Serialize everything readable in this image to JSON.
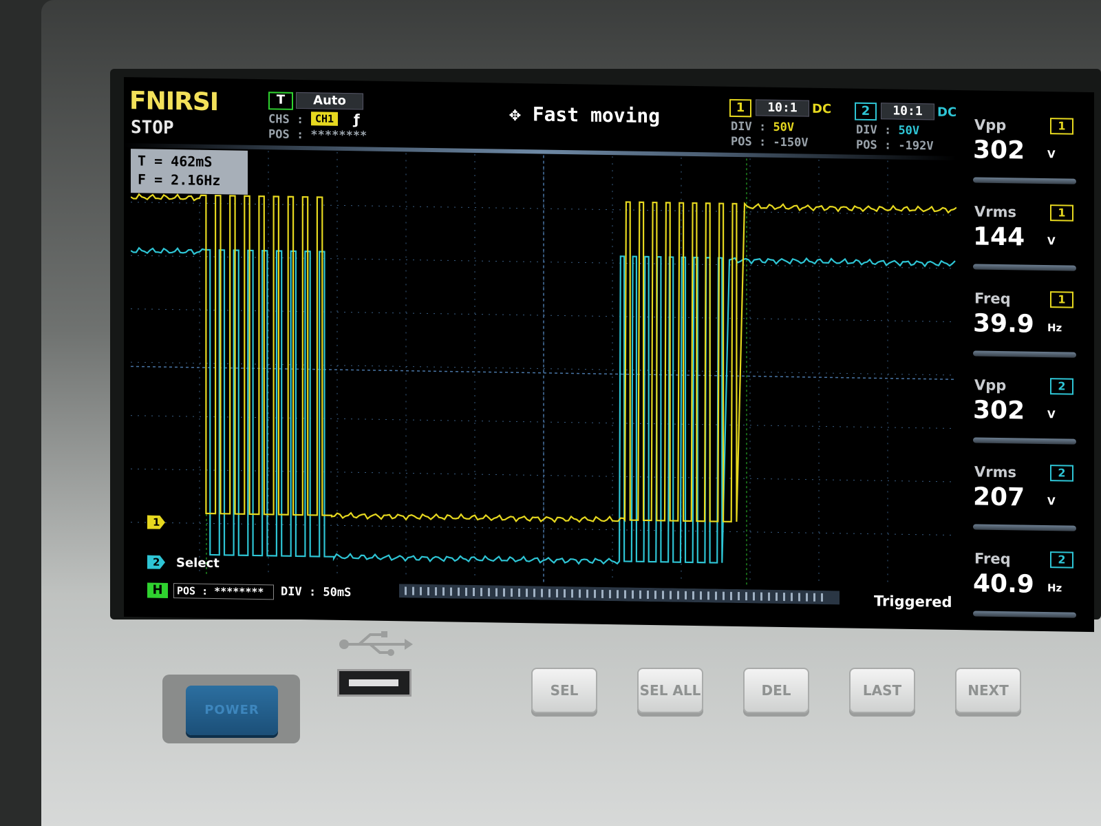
{
  "brand": "FNIRSI",
  "run_state": "STOP",
  "trigger": {
    "badge": "T",
    "mode": "Auto",
    "source_label": "CHS :",
    "source": "CH1",
    "edge_symbol": "ƒ",
    "pos_label": "POS : ********"
  },
  "mode_text": "Fast moving",
  "channels": [
    {
      "badge": "1",
      "probe": "10:1",
      "coupling": "DC",
      "div_label": "DIV :",
      "div": "50V",
      "pos": "POS : -150V",
      "color": "#e6d81f"
    },
    {
      "badge": "2",
      "probe": "10:1",
      "coupling": "DC",
      "div_label": "DIV :",
      "div": "50V",
      "pos": "POS : -192V",
      "color": "#2ec5d5"
    }
  ],
  "cursor_measure": {
    "t": "T  = 462mS",
    "f": "F  = 2.16Hz"
  },
  "markers": {
    "ch1": "1",
    "ch2": "2",
    "select": "Select"
  },
  "horizontal": {
    "badge": "H",
    "pos": "POS : ********",
    "div": "DIV : 50mS"
  },
  "status": "Triggered",
  "measurements": [
    {
      "name": "Vpp",
      "channel": "1",
      "value": "302",
      "unit": "V"
    },
    {
      "name": "Vrms",
      "channel": "1",
      "value": "144",
      "unit": "V"
    },
    {
      "name": "Freq",
      "channel": "1",
      "value": "39.9",
      "unit": "Hz"
    },
    {
      "name": "Vpp",
      "channel": "2",
      "value": "302",
      "unit": "V"
    },
    {
      "name": "Vrms",
      "channel": "2",
      "value": "207",
      "unit": "V"
    },
    {
      "name": "Freq",
      "channel": "2",
      "value": "40.9",
      "unit": "Hz"
    }
  ],
  "front_panel": {
    "power_label": "POWER",
    "buttons": [
      "SEL",
      "SEL ALL",
      "DEL",
      "LAST",
      "NEXT"
    ]
  },
  "colors": {
    "ch1": "#e6d81f",
    "ch2": "#2ec5d5",
    "trigger_green": "#2fd22f",
    "grid": "#3a5f86"
  },
  "icons": {
    "mode": "move-arrows-icon",
    "usb": "usb-icon",
    "edge": "rising-edge-icon"
  }
}
